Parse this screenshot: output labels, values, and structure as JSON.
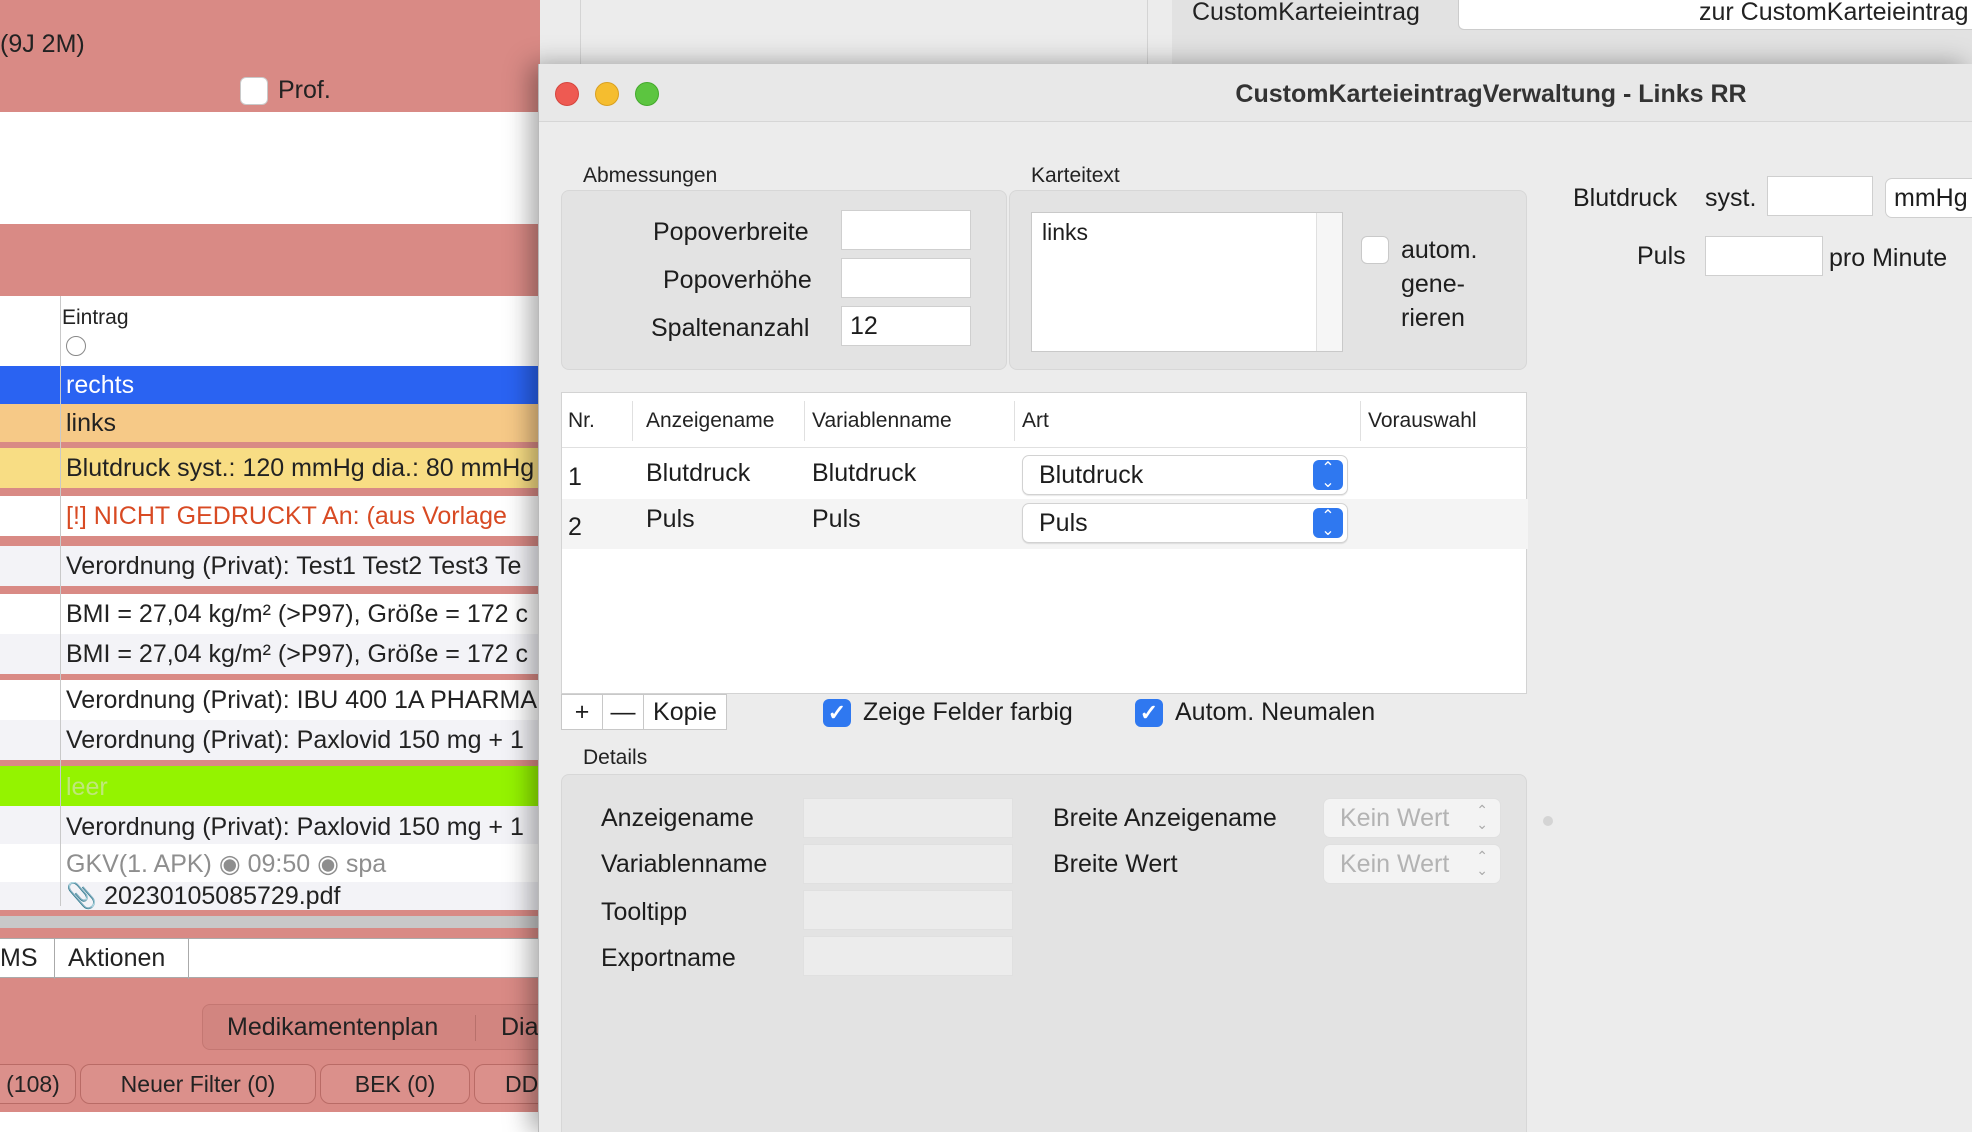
{
  "background_app": {
    "age_text": "(9J 2M)",
    "prof_label": "Prof.",
    "column_header": "Eintrag",
    "rows": [
      "rechts",
      "links",
      "Blutdruck syst.: 120 mmHg  dia.: 80 mmHg",
      "[!] NICHT GEDRUCKT An:   (aus Vorlage",
      "Verordnung (Privat): Test1 Test2 Test3 Te",
      "BMI = 27,04 kg/m² (>P97), Größe = 172 c",
      "BMI = 27,04 kg/m² (>P97), Größe = 172 c",
      "Verordnung (Privat): IBU 400 1A PHARMA",
      "Verordnung (Privat): Paxlovid 150 mg + 1",
      "leer",
      "Verordnung (Privat): Paxlovid 150 mg + 1",
      "GKV(1. APK) ◉ 09:50 ◉ spa",
      "📎 20230105085729.pdf"
    ],
    "tab_ms": "MS",
    "tab_aktionen": "Aktionen",
    "btn_medikamentenplan": "Medikamentenplan",
    "btn_dia": "Dia",
    "filter_108": "(108)",
    "filter_neuer": "Neuer Filter (0)",
    "filter_bek": "BEK (0)",
    "filter_dd": "DD"
  },
  "top_window": {
    "label": "CustomKarteieintrag",
    "field_value": "zur CustomKarteieintrag"
  },
  "window": {
    "title": "CustomKarteieintragVerwaltung - Links RR",
    "abmessungen": {
      "section_label": "Abmessungen",
      "popoverbreite_label": "Popoverbreite",
      "popoverbreite_value": "",
      "popoverhoehe_label": "Popoverhöhe",
      "popoverhoehe_value": "",
      "spaltenanzahl_label": "Spaltenanzahl",
      "spaltenanzahl_value": "12"
    },
    "karteitext": {
      "section_label": "Karteitext",
      "text": "links",
      "autom_line1": "autom.",
      "autom_line2": "gene-",
      "autom_line3": "rieren"
    },
    "preview": {
      "blutdruck_label": "Blutdruck",
      "syst_label": "syst.",
      "syst_value": "",
      "unit_mmhg": "mmHg",
      "puls_label": "Puls",
      "puls_value": "",
      "pro_minute": "pro Minute"
    },
    "table": {
      "headers": [
        "Nr.",
        "Anzeigename",
        "Variablenname",
        "Art",
        "Vorauswahl"
      ],
      "rows": [
        {
          "nr": "1",
          "anzeigename": "Blutdruck",
          "variablenname": "Blutdruck",
          "art": "Blutdruck",
          "vorauswahl": ""
        },
        {
          "nr": "2",
          "anzeigename": "Puls",
          "variablenname": "Puls",
          "art": "Puls",
          "vorauswahl": ""
        }
      ]
    },
    "toolbar": {
      "add_label": "+",
      "remove_label": "—",
      "kopie_label": "Kopie",
      "zeige_felder_label": "Zeige Felder farbig",
      "autom_neumalen_label": "Autom. Neumalen"
    },
    "details": {
      "section_label": "Details",
      "anzeigename_label": "Anzeigename",
      "variablenname_label": "Variablenname",
      "tooltipp_label": "Tooltipp",
      "exportname_label": "Exportname",
      "breite_anzeigename_label": "Breite Anzeigename",
      "breite_anzeigename_value": "Kein Wert",
      "breite_wert_label": "Breite Wert",
      "breite_wert_value": "Kein Wert"
    }
  }
}
